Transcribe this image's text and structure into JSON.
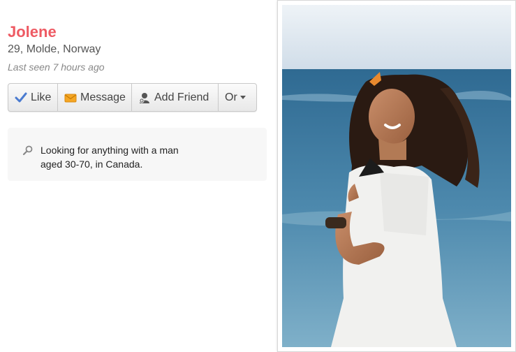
{
  "profile": {
    "name": "Jolene",
    "details": "29, Molde, Norway",
    "last_seen": "Last seen 7 hours ago"
  },
  "actions": {
    "like": "Like",
    "message": "Message",
    "add_friend": "Add Friend",
    "or": "Or"
  },
  "looking_for": {
    "line1": "Looking for anything with a man",
    "line2": "aged 30-70, in Canada."
  },
  "colors": {
    "name": "#ee5a63",
    "like_check": "#4a7bd0",
    "message_envelope": "#f5a623"
  },
  "icons": {
    "like": "check-icon",
    "message": "envelope-icon",
    "add_friend": "person-add-icon",
    "or": "caret-down-icon",
    "looking_for": "search-icon"
  }
}
